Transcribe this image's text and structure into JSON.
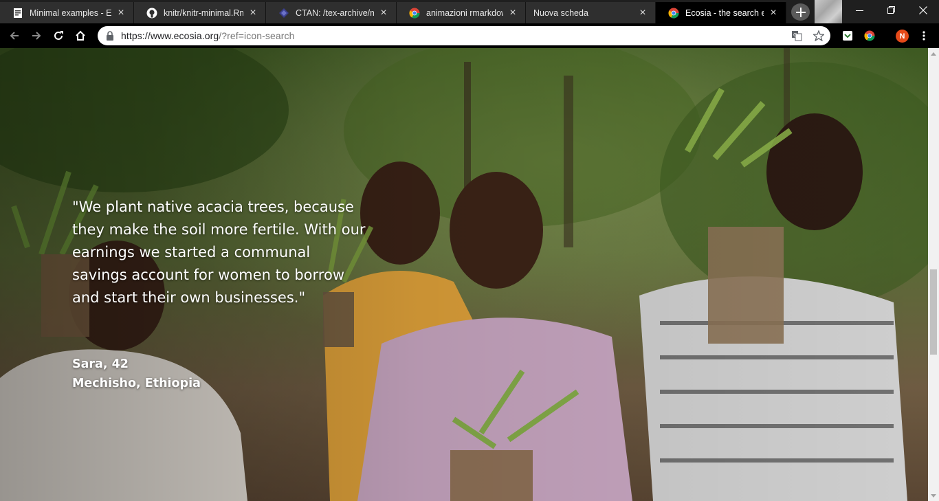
{
  "browser": {
    "tabs": [
      {
        "title": "Minimal examples - Exa",
        "icon": "document-icon",
        "active": false
      },
      {
        "title": "knitr/knitr-minimal.Rmd",
        "icon": "github-icon",
        "active": false
      },
      {
        "title": "CTAN: /tex-archive/mac",
        "icon": "ctan-icon",
        "active": false
      },
      {
        "title": "animazioni rmarkdown",
        "icon": "chrome-icon",
        "active": false
      },
      {
        "title": "Nuova scheda",
        "icon": "",
        "active": false
      },
      {
        "title": "Ecosia - the search eng",
        "icon": "chrome-icon",
        "active": true
      }
    ],
    "address": {
      "host": "https://www.ecosia.org",
      "path": "/?ref=icon-search"
    },
    "profile_initial": "N"
  },
  "page": {
    "quote": "\"We plant native acacia trees, because they make the soil more fertile. With our earnings we started a communal savings account for women to borrow and start their own businesses.\"",
    "person_name": "Sara, 42",
    "person_location": "Mechisho, Ethiopia"
  },
  "colors": {
    "tabstrip": "#1f1f1f",
    "active_tab": "#000000",
    "toolbar": "#000000",
    "profile_avatar": "#e64a19",
    "quote_text": "#ffffff"
  }
}
